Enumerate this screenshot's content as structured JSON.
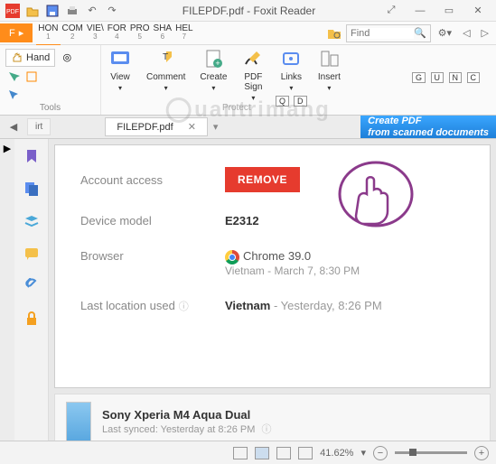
{
  "titlebar": {
    "title": "FILEPDF.pdf - Foxit Reader"
  },
  "ribbon": {
    "file_label": "F",
    "tabs": [
      {
        "top": "HON",
        "sub": "1"
      },
      {
        "top": "COM",
        "sub": "2"
      },
      {
        "top": "VIE\\",
        "sub": "3"
      },
      {
        "top": "FOR",
        "sub": "4"
      },
      {
        "top": "PRO",
        "sub": "5"
      },
      {
        "top": "SHA",
        "sub": "6"
      },
      {
        "top": "HEL",
        "sub": "7"
      }
    ],
    "find_placeholder": "Find",
    "right_hints": [
      "G",
      "U",
      "N",
      "C"
    ],
    "hand_label": "Hand",
    "tools_label": "Tools",
    "protect_label": "Protect",
    "buttons": {
      "view": "View",
      "comment": "Comment",
      "create": "Create",
      "pdf_sign": "PDF\nSign",
      "links": "Links",
      "insert": "Insert"
    },
    "qd_hints": [
      "Q",
      "D"
    ]
  },
  "tabstrip": {
    "start": "irt",
    "doc": "FILEPDF.pdf",
    "promo_line1": "Create PDF",
    "promo_line2": "from scanned documents"
  },
  "document": {
    "rows": {
      "account_access": {
        "label": "Account access",
        "button": "REMOVE"
      },
      "device_model": {
        "label": "Device model",
        "value": "E2312"
      },
      "browser": {
        "label": "Browser",
        "value": "Chrome 39.0",
        "sub": "Vietnam - March 7, 8:30 PM"
      },
      "last_location": {
        "label": "Last location used",
        "value": "Vietnam",
        "sub": " - Yesterday, 8:26 PM"
      }
    },
    "device_card": {
      "name": "Sony Xperia M4 Aqua Dual",
      "sync": "Last synced: Yesterday at 8:26 PM"
    }
  },
  "statusbar": {
    "zoom": "41.62%"
  }
}
